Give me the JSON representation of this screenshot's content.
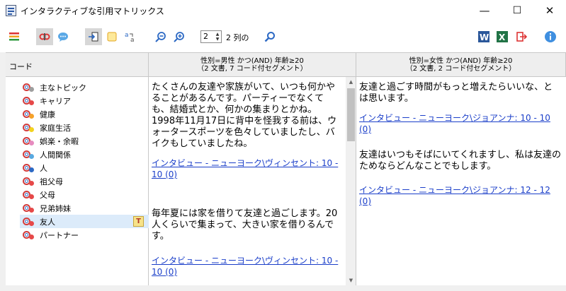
{
  "window": {
    "title": "インタラクティブな引用マトリックス",
    "controls": {
      "minimize": "—",
      "maximize": "☐",
      "close": "✕"
    }
  },
  "toolbar": {
    "left_icons": [
      "code-list-icon",
      "link-activate-icon",
      "memo-bubble-icon"
    ],
    "mid_icons": [
      "export-icon",
      "yellow-note-icon",
      "font-size-icon"
    ],
    "zoom_icons": [
      "zoom-out-icon",
      "zoom-in-icon"
    ],
    "columns_stepper_value": "2",
    "columns_label": "2 列の",
    "search_icon": "search-icon",
    "right_icons": [
      "word-export-icon",
      "excel-export-icon",
      "exit-icon",
      "info-icon"
    ]
  },
  "header": {
    "code_label": "コード",
    "columns": [
      {
        "line1": "性別=男性 かつ(AND) 年齢≥20",
        "line2": "（2 文書, 7 コード付セグメント）"
      },
      {
        "line1": "性別=女性 かつ(AND) 年齢≥20",
        "line2": "（2 文書, 2 コード付セグメント）"
      }
    ]
  },
  "codes": [
    {
      "label": "主なトピック",
      "color": "#9e9e9e"
    },
    {
      "label": "キャリア",
      "color": "#e64848"
    },
    {
      "label": "健康",
      "color": "#f5a12a"
    },
    {
      "label": "家庭生活",
      "color": "#f2d21e"
    },
    {
      "label": "娯楽・余暇",
      "color": "#e68bbf"
    },
    {
      "label": "人間関係",
      "color": "#58a9e0"
    },
    {
      "label": "人",
      "color": "#2c69c4"
    },
    {
      "label": "祖父母",
      "color": "#e64848"
    },
    {
      "label": "父母",
      "color": "#e64848"
    },
    {
      "label": "兄弟姉妹",
      "color": "#e64848"
    },
    {
      "label": "友人",
      "color": "#e64848",
      "selected": true,
      "badge": "T"
    },
    {
      "label": "パートナー",
      "color": "#e64848"
    }
  ],
  "column1": [
    {
      "text": "たくさんの友達や家族がいて、いつも何かやることがあるんです。パーティーでなくても、結婚式とか、何かの集まりとかね。1998年11月17日に背中を怪我する前は、ウォータースポーツを色々していましたし、バイクもしていましたね。",
      "link": "インタビュー - ニューヨーク\\ヴィンセント: 10 - 10 (0)"
    },
    {
      "text": "毎年夏には家を借りて友達と過ごします。20人くらいで集まって、大きい家を借りるんです。",
      "link": "インタビュー - ニューヨーク\\ヴィンセント: 10 - 10 (0)"
    }
  ],
  "column2": [
    {
      "text": "友達と過ごす時間がもっと増えたらいいな、とは思います。",
      "link": "インタビュー - ニューヨーク\\ジョアンナ: 10 - 10 (0)"
    },
    {
      "text": "友達はいつもそばにいてくれますし、私は友達のためならどんなことでもします。",
      "link": "インタビュー - ニューヨーク\\ジョアンナ: 12 - 12 (0)"
    }
  ]
}
